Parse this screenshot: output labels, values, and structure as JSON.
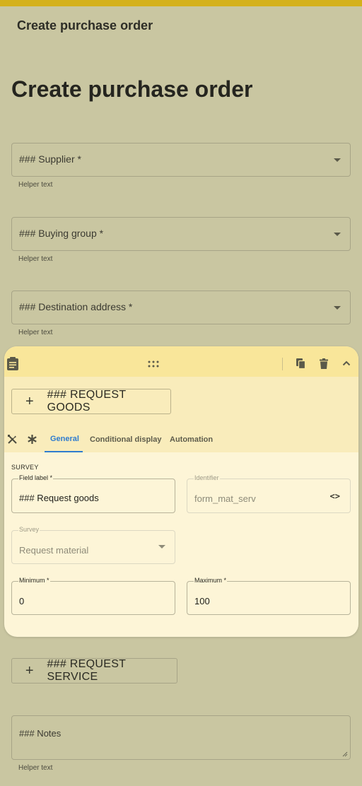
{
  "app": {
    "title": "Create purchase order"
  },
  "page": {
    "heading": "Create purchase order"
  },
  "fields": {
    "supplier": {
      "label": "### Supplier *",
      "helper": "Helper text"
    },
    "buying_group": {
      "label": "### Buying group *",
      "helper": "Helper text"
    },
    "destination": {
      "label": "### Destination address *",
      "helper": "Helper text"
    }
  },
  "panel": {
    "header_icons": [
      "clipboard-icon",
      "drag-handle-icon",
      "copy-icon",
      "delete-icon",
      "chevron-up-icon"
    ],
    "request_goods_button": "### REQUEST GOODS",
    "tabs": [
      {
        "label": "General",
        "active": true
      },
      {
        "label": "Conditional display",
        "active": false
      },
      {
        "label": "Automation",
        "active": false
      }
    ],
    "section_title": "SURVEY",
    "field_label": {
      "label": "Field label *",
      "value": "### Request goods"
    },
    "identifier": {
      "label": "Identifier",
      "value": "form_mat_serv"
    },
    "survey": {
      "label": "Survey",
      "value": "Request material"
    },
    "minimum": {
      "label": "Minimum *",
      "value": "0"
    },
    "maximum": {
      "label": "Maximum *",
      "value": "100"
    }
  },
  "request_service_button": "### REQUEST SERVICE",
  "notes": {
    "label": "### Notes",
    "helper": "Helper text"
  },
  "colors": {
    "background": "#c9c6a1",
    "top_bar": "#d4b11c",
    "panel_header": "#f9e69a",
    "panel_body": "#fdf5d7",
    "active_tab": "#2f7ccf"
  }
}
